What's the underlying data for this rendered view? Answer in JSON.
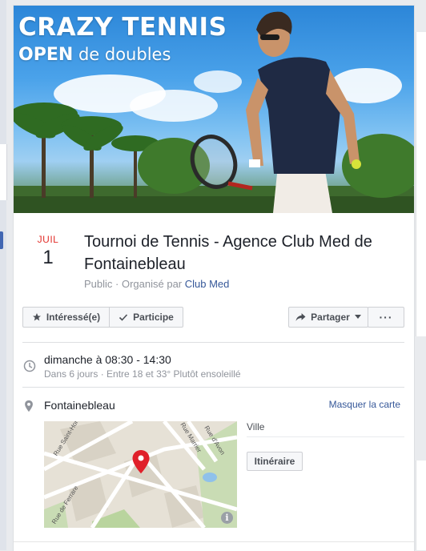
{
  "cover": {
    "title": "CRAZY TENNIS",
    "subtitle_strong": "OPEN",
    "subtitle_rest": " de doubles"
  },
  "event": {
    "month": "JUIL",
    "day": "1",
    "title": "Tournoi de Tennis - Agence Club Med de Fontainebleau",
    "visibility": "Public",
    "separator": " · ",
    "organized_by": "Organisé par ",
    "host": "Club Med"
  },
  "actions": {
    "interested": "Intéressé(e)",
    "going": "Participe",
    "share": "Partager",
    "more": "···"
  },
  "details": {
    "time": "dimanche à 08:30 - 14:30",
    "time_sub": "Dans 6 jours · Entre 18 et 33° Plutôt ensoleillé",
    "location": "Fontainebleau",
    "hide_map": "Masquer la carte",
    "city": "Ville",
    "route": "Itinéraire"
  },
  "map": {
    "streets": [
      "Rue Saint-Hon",
      "Rue de Ferrare",
      "Rue Marrier",
      "Rue d'Avon"
    ],
    "info": "i"
  },
  "colors": {
    "accent": "#4267b2",
    "link": "#365899",
    "date_red": "#e2302b",
    "pin": "#e0202a"
  },
  "icons": [
    "star-icon",
    "check-icon",
    "share-arrow-icon",
    "caret-down-icon",
    "clock-icon",
    "location-pin-icon",
    "map-pin-icon",
    "info-icon"
  ]
}
